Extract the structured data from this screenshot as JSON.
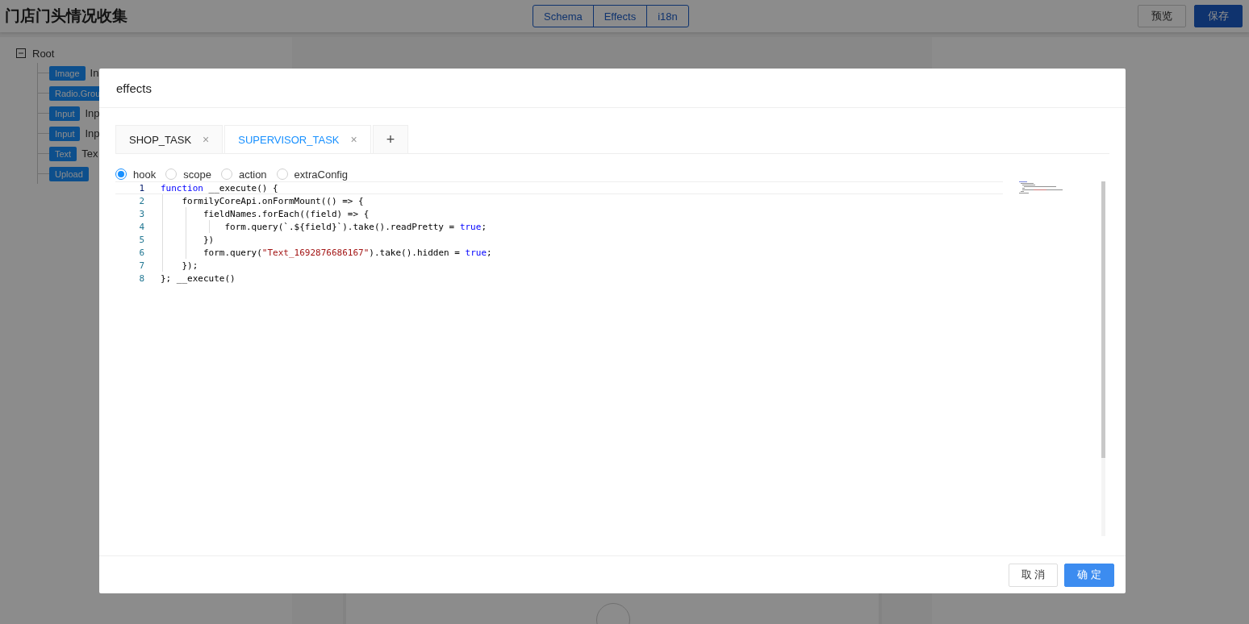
{
  "header": {
    "title": "门店门头情况收集",
    "views": [
      {
        "label": "Schema",
        "selected": false
      },
      {
        "label": "Effects",
        "selected": false
      },
      {
        "label": "i18n",
        "selected": false
      }
    ],
    "actions": [
      {
        "label": "预览",
        "kind": "default"
      },
      {
        "label": "保存",
        "kind": "primary"
      }
    ]
  },
  "tree": {
    "root": {
      "label": "Root",
      "expanded": true,
      "children": [
        {
          "tag": "Image",
          "label": "In"
        },
        {
          "tag": "Radio.Grou"
        },
        {
          "tag": "Input",
          "label": "Inp"
        },
        {
          "tag": "Input",
          "label": "Inp"
        },
        {
          "tag": "Text",
          "label": "Tex"
        },
        {
          "tag": "Upload"
        }
      ]
    }
  },
  "modal": {
    "title": "effects",
    "tabs": [
      {
        "label": "SHOP_TASK",
        "selected": false,
        "close": "×"
      },
      {
        "label": "SUPERVISOR_TASK",
        "selected": true,
        "close": "×"
      }
    ],
    "add_tab": "+",
    "radios": [
      {
        "label": "hook",
        "selected": true
      },
      {
        "label": "scope",
        "selected": false
      },
      {
        "label": "action",
        "selected": false
      },
      {
        "label": "extraConfig",
        "selected": false
      }
    ],
    "code_lines": [
      {
        "number": "1",
        "tokens": [
          {
            "text": "function",
            "kind": "keyword"
          },
          {
            "text": " __execute() {",
            "kind": "plain"
          }
        ]
      },
      {
        "number": "2",
        "tokens": [
          {
            "text": "    formilyCoreApi.onFormMount(() => {",
            "kind": "plain"
          }
        ]
      },
      {
        "number": "3",
        "tokens": [
          {
            "text": "        fieldNames.forEach((field) => {",
            "kind": "plain"
          }
        ]
      },
      {
        "number": "4",
        "tokens": [
          {
            "text": "            form.query(`.${field}`).take().readPretty = ",
            "kind": "plain"
          },
          {
            "text": "true",
            "kind": "keyword"
          },
          {
            "text": ";",
            "kind": "plain"
          }
        ]
      },
      {
        "number": "5",
        "tokens": [
          {
            "text": "        })",
            "kind": "plain"
          }
        ]
      },
      {
        "number": "6",
        "tokens": [
          {
            "text": "        form.query(",
            "kind": "plain"
          },
          {
            "text": "\"Text_1692876686167\"",
            "kind": "string"
          },
          {
            "text": ").take().hidden = ",
            "kind": "plain"
          },
          {
            "text": "true",
            "kind": "keyword"
          },
          {
            "text": ";",
            "kind": "plain"
          }
        ]
      },
      {
        "number": "7",
        "tokens": [
          {
            "text": "    });",
            "kind": "plain"
          }
        ]
      },
      {
        "number": "8",
        "tokens": [
          {
            "text": "}; __execute()",
            "kind": "plain"
          }
        ]
      }
    ],
    "buttons": [
      {
        "label": "取 消",
        "kind": "default"
      },
      {
        "label": "确 定",
        "kind": "primary"
      }
    ]
  }
}
